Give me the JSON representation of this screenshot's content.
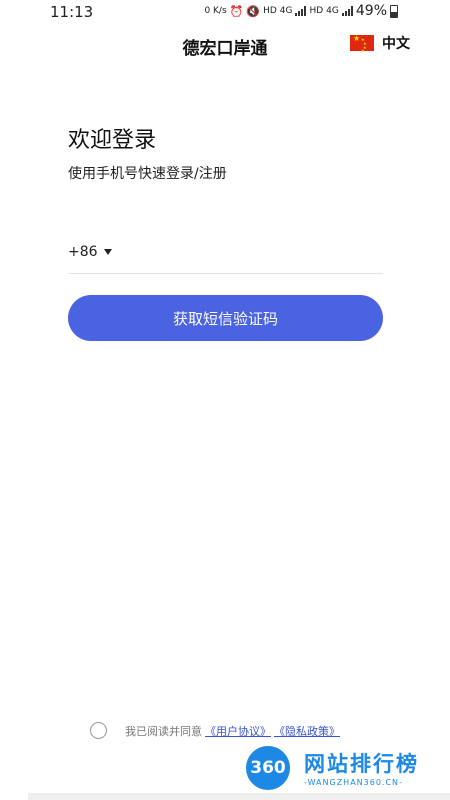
{
  "status_bar": {
    "time": "11:13",
    "net_speed": "0 K/s",
    "hd1": "HD",
    "net1": "4G",
    "hd2": "HD",
    "net2": "4G",
    "battery": "49%"
  },
  "header": {
    "title": "德宏口岸通",
    "language": "中文",
    "flag_icon": "china-flag-icon"
  },
  "welcome": {
    "title": "欢迎登录",
    "subtitle": "使用手机号快速登录/注册"
  },
  "phone": {
    "country_code": "+86",
    "value": "",
    "placeholder": ""
  },
  "actions": {
    "sms_button_label": "获取短信验证码"
  },
  "agreement": {
    "text": "我已阅读并同意",
    "user_agreement": "《用户协议》",
    "privacy_policy": "《隐私政策》"
  },
  "watermark": {
    "logo": "360",
    "name": "网站排行榜",
    "sub": "-WANGZHAN360.CN-"
  },
  "colors": {
    "primary": "#4a63e0",
    "link": "#3a53d0",
    "watermark": "#1e88e5"
  }
}
